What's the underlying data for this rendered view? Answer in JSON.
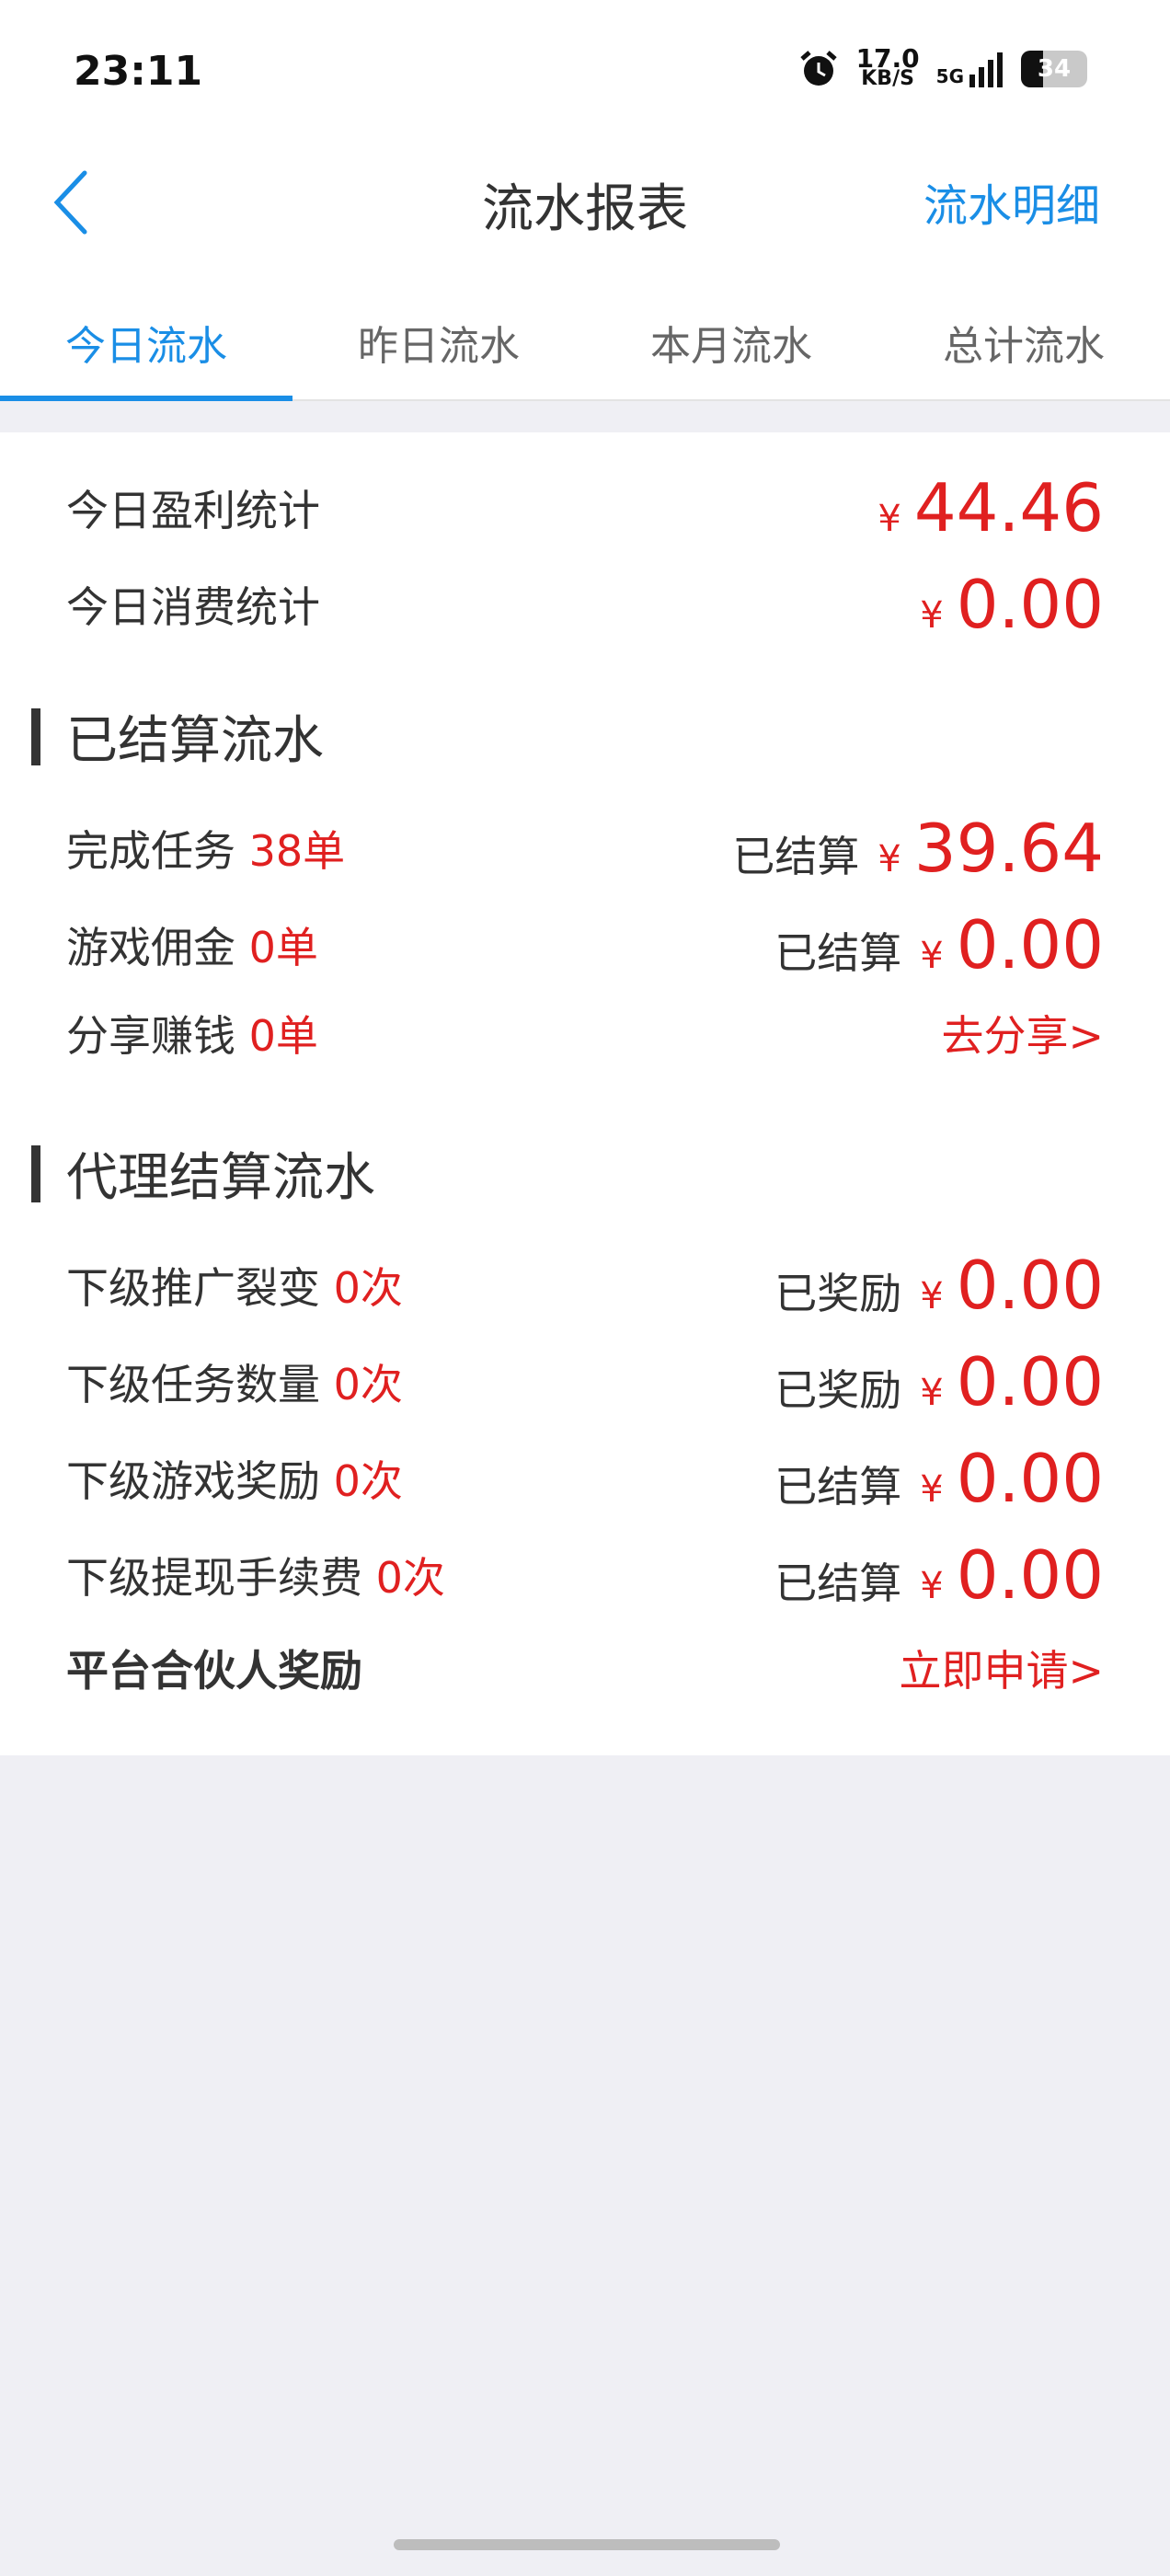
{
  "status": {
    "time": "23:11",
    "speed_value": "17.0",
    "speed_unit": "KB/S",
    "network": "5G",
    "battery": "34",
    "battery_level": 0.34
  },
  "nav": {
    "title": "流水报表",
    "right_link": "流水明细"
  },
  "tabs": [
    "今日流水",
    "昨日流水",
    "本月流水",
    "总计流水"
  ],
  "summary": {
    "profit_label": "今日盈利统计",
    "profit_yen": "¥",
    "profit_value": "44.46",
    "expense_label": "今日消费统计",
    "expense_yen": "¥",
    "expense_value": "0.00"
  },
  "settled": {
    "title": "已结算流水",
    "rows": [
      {
        "label": "完成任务",
        "count": "38单",
        "status": "已结算",
        "yen": "¥",
        "amount": "39.64"
      },
      {
        "label": "游戏佣金",
        "count": "0单",
        "status": "已结算",
        "yen": "¥",
        "amount": "0.00"
      },
      {
        "label": "分享赚钱",
        "count": "0单",
        "link": "去分享>"
      }
    ]
  },
  "agent": {
    "title": "代理结算流水",
    "rows": [
      {
        "label": "下级推广裂变",
        "count": "0次",
        "status": "已奖励",
        "yen": "¥",
        "amount": "0.00"
      },
      {
        "label": "下级任务数量",
        "count": "0次",
        "status": "已奖励",
        "yen": "¥",
        "amount": "0.00"
      },
      {
        "label": "下级游戏奖励",
        "count": "0次",
        "status": "已结算",
        "yen": "¥",
        "amount": "0.00"
      },
      {
        "label": "下级提现手续费",
        "count": "0次",
        "status": "已结算",
        "yen": "¥",
        "amount": "0.00"
      }
    ],
    "partner_label": "平台合伙人奖励",
    "partner_link": "立即申请>"
  },
  "colors": {
    "accent": "#1a8ee6",
    "money": "#e02020",
    "background": "#efeff4"
  }
}
